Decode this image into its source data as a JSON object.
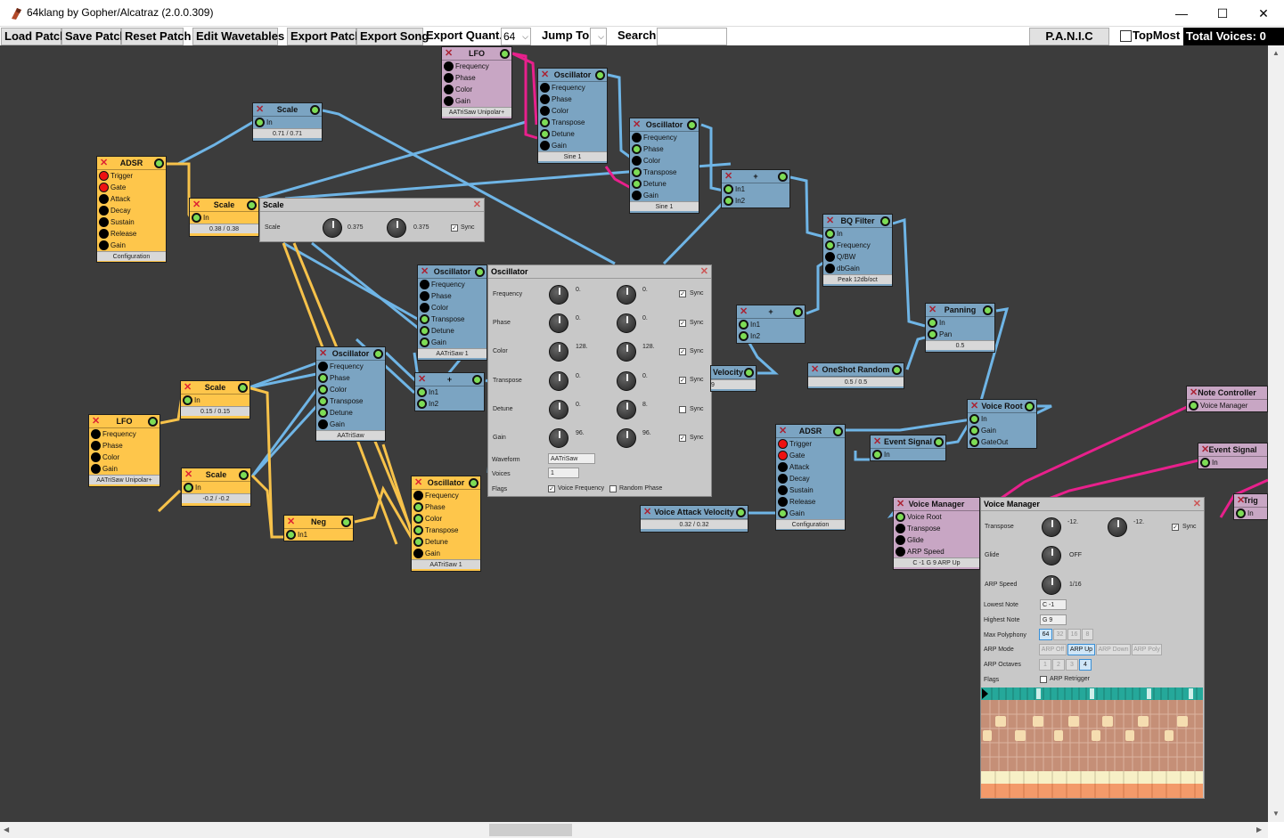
{
  "window": {
    "title": "64klang by Gopher/Alcatraz (2.0.0.309)",
    "minimize": "—",
    "maximize": "☐",
    "close": "✕"
  },
  "toolbar": {
    "load_patch": "Load Patch",
    "save_patch": "Save Patch",
    "reset_patch": "Reset Patch",
    "edit_wavetables": "Edit Wavetables",
    "export_patch": "Export Patch",
    "export_song": "Export Song",
    "export_quant_label": "Export Quant.:",
    "export_quant_value": "64",
    "jump_to_label": "Jump To:",
    "jump_to_value": "",
    "search_label": "Search:",
    "search_value": "",
    "panic": "P.A.N.I.C",
    "topmost": "TopMost",
    "total_voices": "Total Voices: 0"
  },
  "nodes": {
    "adsr1": {
      "title": "ADSR",
      "inputs": [
        "Trigger",
        "Gate",
        "Attack",
        "Decay",
        "Sustain",
        "Release",
        "Gain"
      ],
      "footer": "Configuration"
    },
    "scale1": {
      "title": "Scale",
      "inputs": [
        "In"
      ],
      "footer": "0.71 / 0.71"
    },
    "scale2": {
      "title": "Scale",
      "inputs": [
        "In"
      ],
      "footer": "0.38 / 0.38"
    },
    "scale3": {
      "title": "Scale",
      "inputs": [
        "In"
      ],
      "footer": "0.15 / 0.15"
    },
    "scale4": {
      "title": "Scale",
      "inputs": [
        "In"
      ],
      "footer": "-0.2 / -0.2"
    },
    "lfo1": {
      "title": "LFO",
      "inputs": [
        "Frequency",
        "Phase",
        "Color",
        "Gain"
      ],
      "footer": "AATriSaw    Unipolar+"
    },
    "lfo2": {
      "title": "LFO",
      "inputs": [
        "Frequency",
        "Phase",
        "Color",
        "Gain"
      ],
      "footer": "AATriSaw    Unipolar+"
    },
    "neg": {
      "title": "Neg",
      "inputs": [
        "In1"
      ]
    },
    "osc1": {
      "title": "Oscillator",
      "inputs": [
        "Frequency",
        "Phase",
        "Color",
        "Transpose",
        "Detune",
        "Gain"
      ],
      "footer": "Sine        1"
    },
    "osc2": {
      "title": "Oscillator",
      "inputs": [
        "Frequency",
        "Phase",
        "Color",
        "Transpose",
        "Detune",
        "Gain"
      ],
      "footer": "Sine        1"
    },
    "osc3": {
      "title": "Oscillator",
      "inputs": [
        "Frequency",
        "Phase",
        "Color",
        "Transpose",
        "Detune",
        "Gain"
      ],
      "footer": "AATriSaw    1"
    },
    "osc4": {
      "title": "Oscillator",
      "inputs": [
        "Frequency",
        "Phase",
        "Color",
        "Transpose",
        "Detune",
        "Gain"
      ],
      "footer": "AATriSaw"
    },
    "osc5": {
      "title": "Oscillator",
      "inputs": [
        "Frequency",
        "Phase",
        "Color",
        "Transpose",
        "Detune",
        "Gain"
      ],
      "footer": "AATriSaw    1"
    },
    "add1": {
      "title": "+",
      "inputs": [
        "In1",
        "In2"
      ]
    },
    "add2": {
      "title": "+",
      "inputs": [
        "In1",
        "In2"
      ]
    },
    "add3": {
      "title": "+",
      "inputs": [
        "In1",
        "In2"
      ]
    },
    "bqfilter": {
      "title": "BQ Filter",
      "inputs": [
        "In",
        "Frequency",
        "Q/BW",
        "dbGain"
      ],
      "footer": "Peak 12db/oct"
    },
    "panning": {
      "title": "Panning",
      "inputs": [
        "In",
        "Pan"
      ],
      "footer": "0.5"
    },
    "oneshot": {
      "title": "OneShot Random",
      "footer": "0.5 / 0.5"
    },
    "velocity": {
      "title": "Velocity",
      "footer": "9"
    },
    "voiceroot": {
      "title": "Voice Root",
      "inputs": [
        "In",
        "Gain",
        "GateOut"
      ]
    },
    "adsr2": {
      "title": "ADSR",
      "inputs": [
        "Trigger",
        "Gate",
        "Attack",
        "Decay",
        "Sustain",
        "Release",
        "Gain"
      ],
      "footer": "Configuration"
    },
    "eventsig1": {
      "title": "Event Signal",
      "inputs": [
        "In"
      ]
    },
    "eventsig2": {
      "title": "Event Signal",
      "inputs": [
        "In"
      ]
    },
    "voiceattack": {
      "title": "Voice Attack Velocity",
      "footer": "0.32 / 0.32"
    },
    "notectrl": {
      "title": "Note Controller",
      "inputs": [
        "Voice Manager"
      ]
    },
    "voicemgr": {
      "title": "Voice Manager",
      "inputs": [
        "Voice Root",
        "Transpose",
        "Glide",
        "ARP Speed"
      ],
      "footer": "C -1 G 9 ARP Up"
    },
    "trig": {
      "title": "Trig",
      "inputs": [
        "In"
      ]
    }
  },
  "scale_panel": {
    "title": "Scale",
    "label": "Scale",
    "value1": "0.375",
    "value2": "0.375",
    "sync": "Sync"
  },
  "osc_panel": {
    "title": "Oscillator",
    "rows": [
      {
        "label": "Frequency",
        "v1": "0.",
        "v2": "0.",
        "sync": "Sync",
        "checked": true
      },
      {
        "label": "Phase",
        "v1": "0.",
        "v2": "0.",
        "sync": "Sync",
        "checked": true
      },
      {
        "label": "Color",
        "v1": "128.",
        "v2": "128.",
        "sync": "Sync",
        "checked": true
      },
      {
        "label": "Transpose",
        "v1": "0.",
        "v2": "0.",
        "sync": "Sync",
        "checked": true
      },
      {
        "label": "Detune",
        "v1": "0.",
        "v2": "8.",
        "sync": "Sync",
        "checked": false
      },
      {
        "label": "Gain",
        "v1": "96.",
        "v2": "96.",
        "sync": "Sync",
        "checked": true
      }
    ],
    "waveform_label": "Waveform",
    "waveform": "AATriSaw",
    "voices_label": "Voices",
    "voices": "1",
    "flags_label": "Flags",
    "flag1": "Voice Frequency",
    "flag2": "Random Phase"
  },
  "vm_panel": {
    "title": "Voice Manager",
    "transpose_label": "Transpose",
    "transpose1": "-12.",
    "transpose2": "-12.",
    "sync": "Sync",
    "glide_label": "Glide",
    "glide": "OFF",
    "arpspeed_label": "ARP Speed",
    "arpspeed": "1/16",
    "lowest_label": "Lowest Note",
    "lowest": "C -1",
    "highest_label": "Highest Note",
    "highest": "G 9",
    "maxpoly_label": "Max Polyphony",
    "maxpoly": [
      "64",
      "32",
      "16",
      "8"
    ],
    "arpmode_label": "ARP Mode",
    "arpmode": [
      "ARP Off",
      "ARP Up",
      "ARP Down",
      "ARP Poly"
    ],
    "arpoct_label": "ARP Octaves",
    "arpoct": [
      "1",
      "2",
      "3",
      "4"
    ],
    "flags_label": "Flags",
    "retrigger": "ARP Retrigger"
  },
  "colors": {
    "canvas": "#3c3c3c",
    "wire_blue": "#6fb5e6",
    "wire_yellow": "#f7c24a",
    "wire_pink": "#e8208c"
  }
}
